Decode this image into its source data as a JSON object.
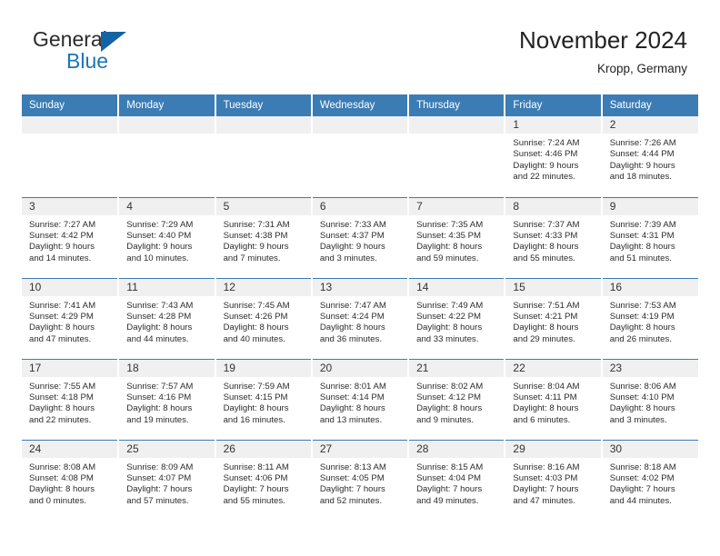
{
  "brand": {
    "word_one": "General",
    "word_two": "Blue",
    "triangle_color": "#1464a5",
    "blue_color": "#1a75bb"
  },
  "header": {
    "title": "November 2024",
    "subtitle": "Kropp, Germany"
  },
  "theme": {
    "header_blue": "#3b7cb5",
    "daynum_gray": "#f0f0f0",
    "text_color": "#2c2c2c"
  },
  "weekday_headers": [
    "Sunday",
    "Monday",
    "Tuesday",
    "Wednesday",
    "Thursday",
    "Friday",
    "Saturday"
  ],
  "labels": {
    "sunrise": "Sunrise:",
    "sunset": "Sunset:",
    "daylight": "Daylight:"
  },
  "weeks": [
    [
      {
        "day": ""
      },
      {
        "day": ""
      },
      {
        "day": ""
      },
      {
        "day": ""
      },
      {
        "day": ""
      },
      {
        "day": "1",
        "sunrise": "Sunrise: 7:24 AM",
        "sunset": "Sunset: 4:46 PM",
        "daylight_1": "Daylight: 9 hours",
        "daylight_2": "and 22 minutes."
      },
      {
        "day": "2",
        "sunrise": "Sunrise: 7:26 AM",
        "sunset": "Sunset: 4:44 PM",
        "daylight_1": "Daylight: 9 hours",
        "daylight_2": "and 18 minutes."
      }
    ],
    [
      {
        "day": "3",
        "sunrise": "Sunrise: 7:27 AM",
        "sunset": "Sunset: 4:42 PM",
        "daylight_1": "Daylight: 9 hours",
        "daylight_2": "and 14 minutes."
      },
      {
        "day": "4",
        "sunrise": "Sunrise: 7:29 AM",
        "sunset": "Sunset: 4:40 PM",
        "daylight_1": "Daylight: 9 hours",
        "daylight_2": "and 10 minutes."
      },
      {
        "day": "5",
        "sunrise": "Sunrise: 7:31 AM",
        "sunset": "Sunset: 4:38 PM",
        "daylight_1": "Daylight: 9 hours",
        "daylight_2": "and 7 minutes."
      },
      {
        "day": "6",
        "sunrise": "Sunrise: 7:33 AM",
        "sunset": "Sunset: 4:37 PM",
        "daylight_1": "Daylight: 9 hours",
        "daylight_2": "and 3 minutes."
      },
      {
        "day": "7",
        "sunrise": "Sunrise: 7:35 AM",
        "sunset": "Sunset: 4:35 PM",
        "daylight_1": "Daylight: 8 hours",
        "daylight_2": "and 59 minutes."
      },
      {
        "day": "8",
        "sunrise": "Sunrise: 7:37 AM",
        "sunset": "Sunset: 4:33 PM",
        "daylight_1": "Daylight: 8 hours",
        "daylight_2": "and 55 minutes."
      },
      {
        "day": "9",
        "sunrise": "Sunrise: 7:39 AM",
        "sunset": "Sunset: 4:31 PM",
        "daylight_1": "Daylight: 8 hours",
        "daylight_2": "and 51 minutes."
      }
    ],
    [
      {
        "day": "10",
        "sunrise": "Sunrise: 7:41 AM",
        "sunset": "Sunset: 4:29 PM",
        "daylight_1": "Daylight: 8 hours",
        "daylight_2": "and 47 minutes."
      },
      {
        "day": "11",
        "sunrise": "Sunrise: 7:43 AM",
        "sunset": "Sunset: 4:28 PM",
        "daylight_1": "Daylight: 8 hours",
        "daylight_2": "and 44 minutes."
      },
      {
        "day": "12",
        "sunrise": "Sunrise: 7:45 AM",
        "sunset": "Sunset: 4:26 PM",
        "daylight_1": "Daylight: 8 hours",
        "daylight_2": "and 40 minutes."
      },
      {
        "day": "13",
        "sunrise": "Sunrise: 7:47 AM",
        "sunset": "Sunset: 4:24 PM",
        "daylight_1": "Daylight: 8 hours",
        "daylight_2": "and 36 minutes."
      },
      {
        "day": "14",
        "sunrise": "Sunrise: 7:49 AM",
        "sunset": "Sunset: 4:22 PM",
        "daylight_1": "Daylight: 8 hours",
        "daylight_2": "and 33 minutes."
      },
      {
        "day": "15",
        "sunrise": "Sunrise: 7:51 AM",
        "sunset": "Sunset: 4:21 PM",
        "daylight_1": "Daylight: 8 hours",
        "daylight_2": "and 29 minutes."
      },
      {
        "day": "16",
        "sunrise": "Sunrise: 7:53 AM",
        "sunset": "Sunset: 4:19 PM",
        "daylight_1": "Daylight: 8 hours",
        "daylight_2": "and 26 minutes."
      }
    ],
    [
      {
        "day": "17",
        "sunrise": "Sunrise: 7:55 AM",
        "sunset": "Sunset: 4:18 PM",
        "daylight_1": "Daylight: 8 hours",
        "daylight_2": "and 22 minutes."
      },
      {
        "day": "18",
        "sunrise": "Sunrise: 7:57 AM",
        "sunset": "Sunset: 4:16 PM",
        "daylight_1": "Daylight: 8 hours",
        "daylight_2": "and 19 minutes."
      },
      {
        "day": "19",
        "sunrise": "Sunrise: 7:59 AM",
        "sunset": "Sunset: 4:15 PM",
        "daylight_1": "Daylight: 8 hours",
        "daylight_2": "and 16 minutes."
      },
      {
        "day": "20",
        "sunrise": "Sunrise: 8:01 AM",
        "sunset": "Sunset: 4:14 PM",
        "daylight_1": "Daylight: 8 hours",
        "daylight_2": "and 13 minutes."
      },
      {
        "day": "21",
        "sunrise": "Sunrise: 8:02 AM",
        "sunset": "Sunset: 4:12 PM",
        "daylight_1": "Daylight: 8 hours",
        "daylight_2": "and 9 minutes."
      },
      {
        "day": "22",
        "sunrise": "Sunrise: 8:04 AM",
        "sunset": "Sunset: 4:11 PM",
        "daylight_1": "Daylight: 8 hours",
        "daylight_2": "and 6 minutes."
      },
      {
        "day": "23",
        "sunrise": "Sunrise: 8:06 AM",
        "sunset": "Sunset: 4:10 PM",
        "daylight_1": "Daylight: 8 hours",
        "daylight_2": "and 3 minutes."
      }
    ],
    [
      {
        "day": "24",
        "sunrise": "Sunrise: 8:08 AM",
        "sunset": "Sunset: 4:08 PM",
        "daylight_1": "Daylight: 8 hours",
        "daylight_2": "and 0 minutes."
      },
      {
        "day": "25",
        "sunrise": "Sunrise: 8:09 AM",
        "sunset": "Sunset: 4:07 PM",
        "daylight_1": "Daylight: 7 hours",
        "daylight_2": "and 57 minutes."
      },
      {
        "day": "26",
        "sunrise": "Sunrise: 8:11 AM",
        "sunset": "Sunset: 4:06 PM",
        "daylight_1": "Daylight: 7 hours",
        "daylight_2": "and 55 minutes."
      },
      {
        "day": "27",
        "sunrise": "Sunrise: 8:13 AM",
        "sunset": "Sunset: 4:05 PM",
        "daylight_1": "Daylight: 7 hours",
        "daylight_2": "and 52 minutes."
      },
      {
        "day": "28",
        "sunrise": "Sunrise: 8:15 AM",
        "sunset": "Sunset: 4:04 PM",
        "daylight_1": "Daylight: 7 hours",
        "daylight_2": "and 49 minutes."
      },
      {
        "day": "29",
        "sunrise": "Sunrise: 8:16 AM",
        "sunset": "Sunset: 4:03 PM",
        "daylight_1": "Daylight: 7 hours",
        "daylight_2": "and 47 minutes."
      },
      {
        "day": "30",
        "sunrise": "Sunrise: 8:18 AM",
        "sunset": "Sunset: 4:02 PM",
        "daylight_1": "Daylight: 7 hours",
        "daylight_2": "and 44 minutes."
      }
    ]
  ]
}
